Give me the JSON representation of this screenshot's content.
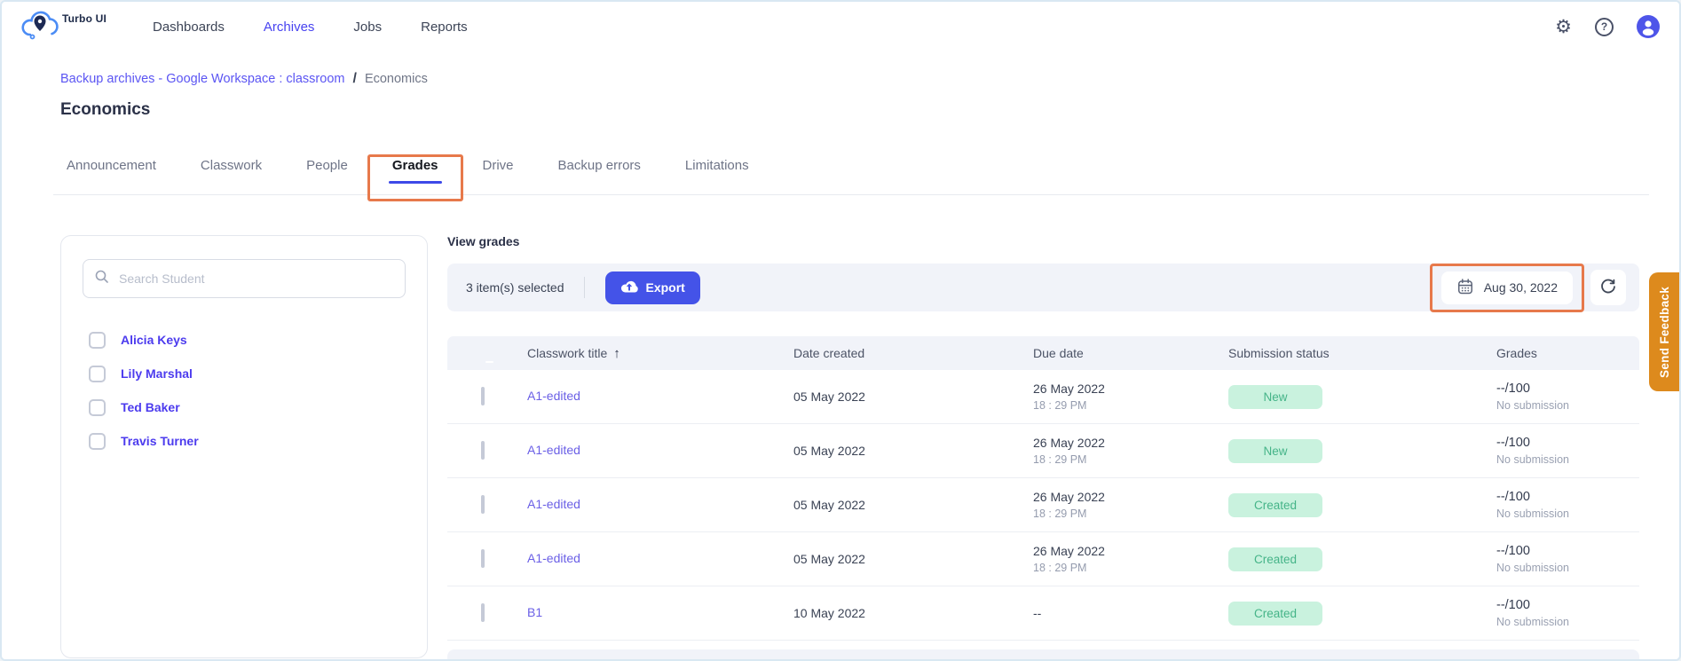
{
  "brand": {
    "name": "Turbo UI"
  },
  "nav": {
    "items": [
      {
        "label": "Dashboards",
        "active": false
      },
      {
        "label": "Archives",
        "active": true
      },
      {
        "label": "Jobs",
        "active": false
      },
      {
        "label": "Reports",
        "active": false
      }
    ]
  },
  "header_icons": {
    "settings": "gear-icon",
    "help": "question-circle-icon",
    "profile": "user-avatar"
  },
  "breadcrumb": {
    "link": "Backup archives - Google Workspace : classroom",
    "separator": "/",
    "current": "Economics"
  },
  "page": {
    "title": "Economics"
  },
  "tabs": [
    {
      "label": "Announcement"
    },
    {
      "label": "Classwork"
    },
    {
      "label": "People"
    },
    {
      "label": "Grades"
    },
    {
      "label": "Drive"
    },
    {
      "label": "Backup errors"
    },
    {
      "label": "Limitations"
    }
  ],
  "active_tab": "Grades",
  "student_panel": {
    "search_placeholder": "Search Student",
    "students": [
      {
        "name": "Alicia Keys"
      },
      {
        "name": "Lily Marshal"
      },
      {
        "name": "Ted Baker"
      },
      {
        "name": "Travis Turner"
      }
    ]
  },
  "grades": {
    "title": "View grades",
    "toolbar": {
      "selected": "3 item(s) selected",
      "export": "Export",
      "date": "Aug 30, 2022"
    },
    "table": {
      "headers": {
        "classwork": "Classwork title",
        "sort_icon": "↑",
        "date_created": "Date created",
        "due_date": "Due date",
        "status": "Submission status",
        "grades": "Grades"
      },
      "rows": [
        {
          "title": "A1-edited",
          "created": "05 May 2022",
          "due": "26 May 2022",
          "due_time": "18 : 29 PM",
          "status": "New",
          "grade": "--/100",
          "note": "No submission"
        },
        {
          "title": "A1-edited",
          "created": "05 May 2022",
          "due": "26 May 2022",
          "due_time": "18 : 29 PM",
          "status": "New",
          "grade": "--/100",
          "note": "No submission"
        },
        {
          "title": "A1-edited",
          "created": "05 May 2022",
          "due": "26 May 2022",
          "due_time": "18 : 29 PM",
          "status": "Created",
          "grade": "--/100",
          "note": "No submission"
        },
        {
          "title": "A1-edited",
          "created": "05 May 2022",
          "due": "26 May 2022",
          "due_time": "18 : 29 PM",
          "status": "Created",
          "grade": "--/100",
          "note": "No submission"
        },
        {
          "title": "B1",
          "created": "10 May 2022",
          "due": "--",
          "due_time": "",
          "status": "Created",
          "grade": "--/100",
          "note": "No submission"
        }
      ]
    }
  },
  "feedback": {
    "label": "Send Feedback"
  },
  "colors": {
    "primary_indigo": "#4453e8",
    "active_link_blue": "#4843f0",
    "breadcrumb_link": "#5b55f3",
    "student_link": "#4c3bee",
    "row_link": "#6a5fe6",
    "tab_underline": "#3d49e8",
    "highlight_orange": "#e7794b",
    "feedback_orange": "#dd8a1d",
    "badge_bg": "#c9f2de",
    "badge_text": "#45b488",
    "bar_bg": "#f1f3f9"
  }
}
